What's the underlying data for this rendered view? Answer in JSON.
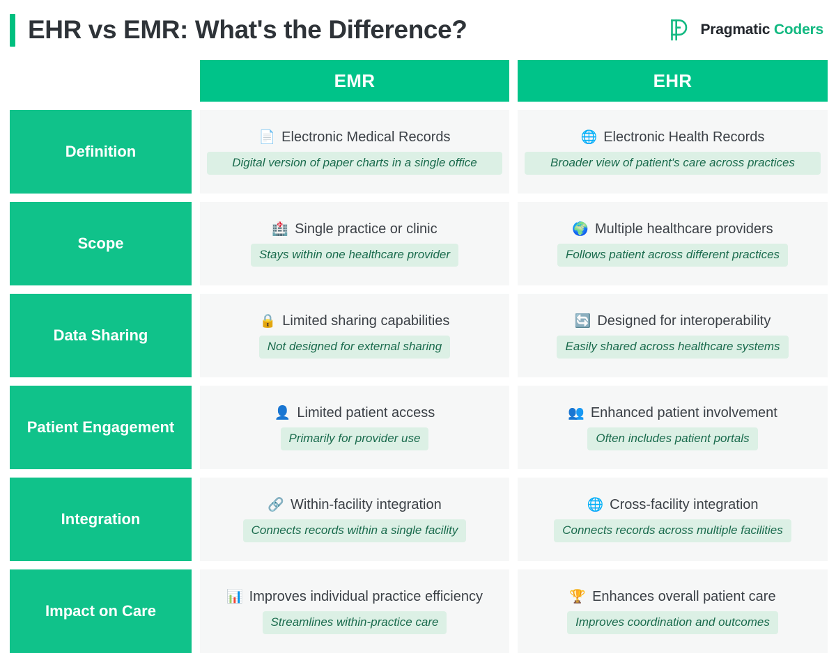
{
  "header": {
    "title": "EHR vs EMR: What's the Difference?",
    "accent_color": "#00bf7f",
    "logo": {
      "mark": "pragmatic-coders-p-logo",
      "word1": "Pragmatic",
      "word2": "Coders",
      "word1_color": "#21252b",
      "word2_color": "#12b981"
    }
  },
  "table": {
    "columns": [
      {
        "label": "",
        "key": "feature"
      },
      {
        "label": "EMR",
        "key": "emr"
      },
      {
        "label": "EHR",
        "key": "ehr"
      }
    ],
    "header_bg": "#00c389",
    "label_bg": "#10c28a",
    "cell_bg": "#f6f7f7",
    "note_bg": "#dcf0e5",
    "note_color": "#1a6b4d",
    "rows": [
      {
        "feature": "Definition",
        "emr": {
          "icon": "page-document-icon",
          "icon_glyph": "📄",
          "title": "Electronic Medical Records",
          "note": "Digital version of paper charts in a single office",
          "note_wide": true
        },
        "ehr": {
          "icon": "globe-meridians-icon",
          "icon_glyph": "🌐",
          "title": "Electronic Health Records",
          "note": "Broader view of patient's care across practices",
          "note_wide": true
        }
      },
      {
        "feature": "Scope",
        "emr": {
          "icon": "hospital-building-icon",
          "icon_glyph": "🏥",
          "title": "Single practice or clinic",
          "note": "Stays within one healthcare provider",
          "note_wide": false
        },
        "ehr": {
          "icon": "earth-globe-icon",
          "icon_glyph": "🌍",
          "title": "Multiple healthcare providers",
          "note": "Follows patient across different practices",
          "note_wide": false
        }
      },
      {
        "feature": "Data Sharing",
        "emr": {
          "icon": "lock-icon",
          "icon_glyph": "🔒",
          "title": "Limited sharing capabilities",
          "note": "Not designed for external sharing",
          "note_wide": false
        },
        "ehr": {
          "icon": "refresh-sync-icon",
          "icon_glyph": "🔄",
          "title": "Designed for interoperability",
          "note": "Easily shared across healthcare systems",
          "note_wide": false
        }
      },
      {
        "feature": "Patient Engagement",
        "emr": {
          "icon": "single-person-icon",
          "icon_glyph": "👤",
          "title": "Limited patient access",
          "note": "Primarily for provider use",
          "note_wide": false
        },
        "ehr": {
          "icon": "two-people-icon",
          "icon_glyph": "👥",
          "title": "Enhanced patient involvement",
          "note": "Often includes patient portals",
          "note_wide": false
        }
      },
      {
        "feature": "Integration",
        "emr": {
          "icon": "link-chain-icon",
          "icon_glyph": "🔗",
          "title": "Within-facility integration",
          "note": "Connects records within a single facility",
          "note_wide": false
        },
        "ehr": {
          "icon": "globe-meridians-icon",
          "icon_glyph": "🌐",
          "title": "Cross-facility integration",
          "note": "Connects records across multiple facilities",
          "note_wide": false
        }
      },
      {
        "feature": "Impact on Care",
        "emr": {
          "icon": "bar-chart-icon",
          "icon_glyph": "📊",
          "title": "Improves individual practice efficiency",
          "note": "Streamlines within-practice care",
          "note_wide": false
        },
        "ehr": {
          "icon": "trophy-icon",
          "icon_glyph": "🏆",
          "title": "Enhances overall patient care",
          "note": "Improves coordination and outcomes",
          "note_wide": false
        }
      }
    ]
  }
}
